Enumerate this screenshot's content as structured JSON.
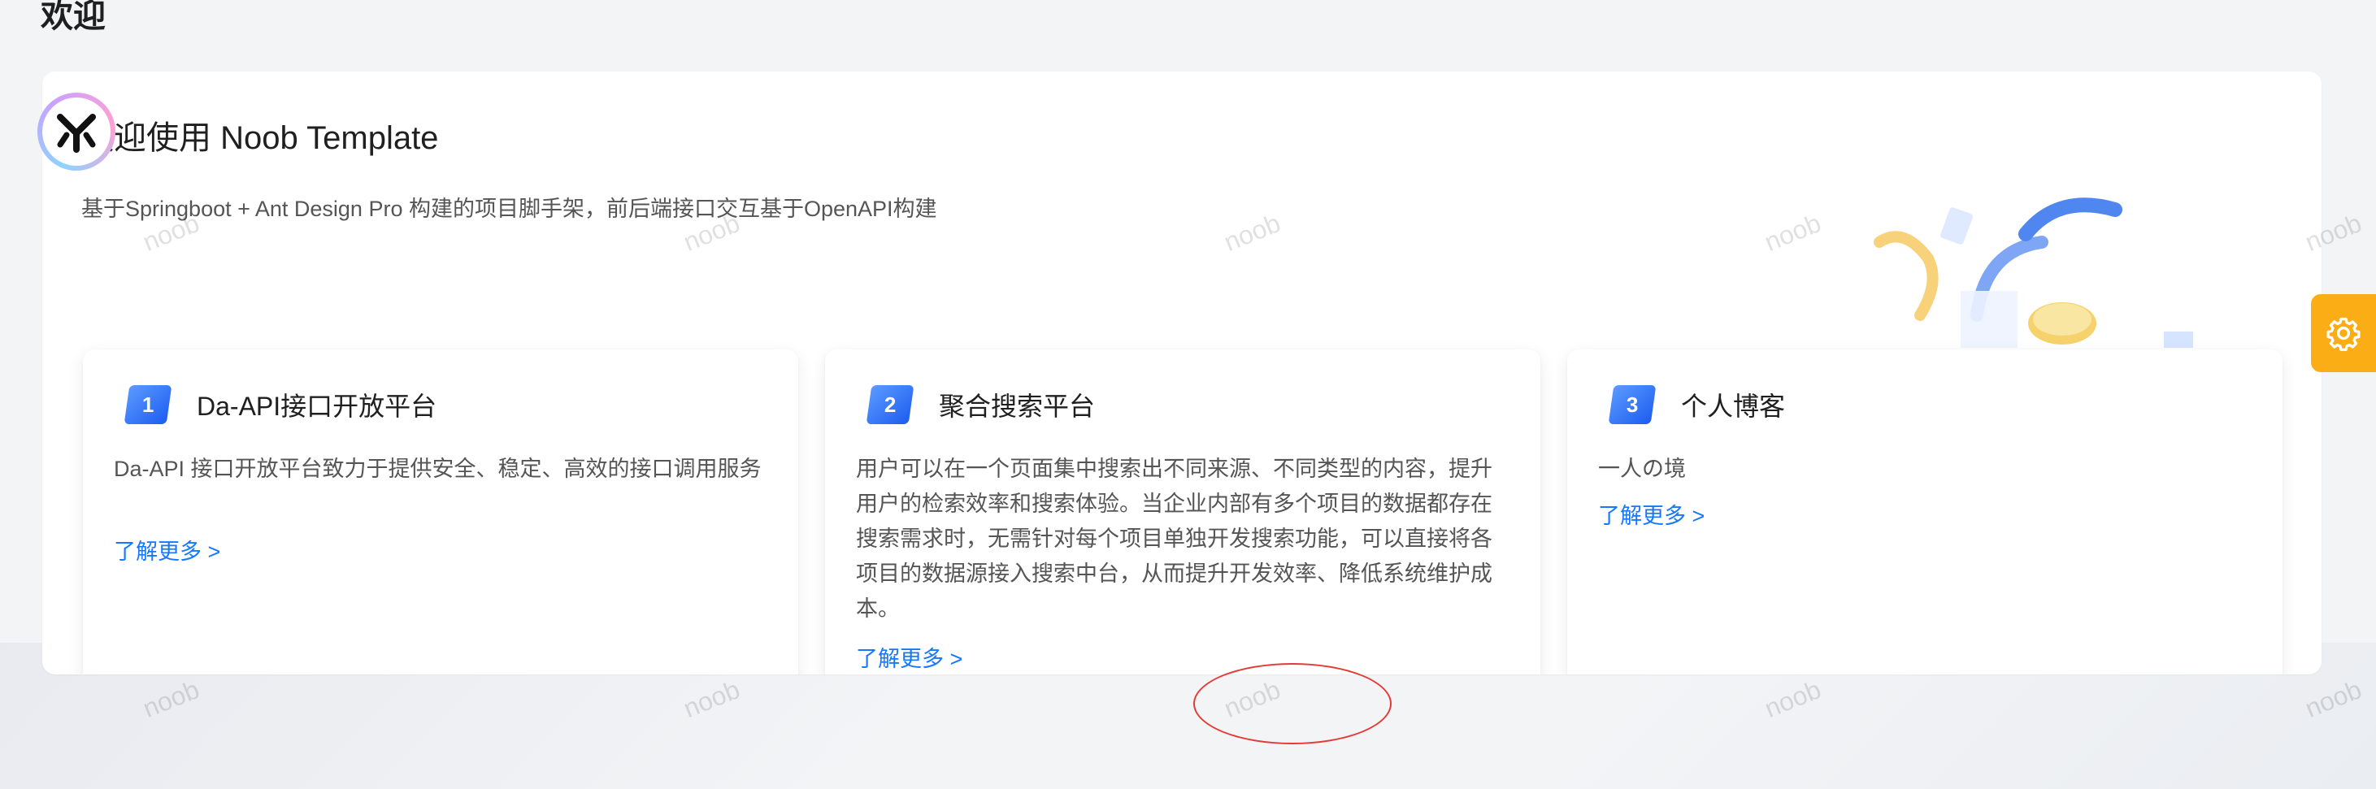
{
  "page": {
    "title": "欢迎"
  },
  "welcome": {
    "title": "欢迎使用 Noob Template",
    "subtitle": "基于Springboot + Ant Design Pro 构建的项目脚手架，前后端接口交互基于OpenAPI构建"
  },
  "cards": [
    {
      "index": "1",
      "title": "Da-API接口开放平台",
      "description": "Da-API 接口开放平台致力于提供安全、稳定、高效的接口调用服务",
      "link": "了解更多 >"
    },
    {
      "index": "2",
      "title": "聚合搜索平台",
      "description": "用户可以在一个页面集中搜索出不同来源、不同类型的内容，提升用户的检索效率和搜索体验。当企业内部有多个项目的数据都存在搜索需求时，无需针对每个项目单独开发搜索功能，可以直接将各项目的数据源接入搜索中台，从而提升开发效率、降低系统维护成本。",
      "link": "了解更多 >"
    },
    {
      "index": "3",
      "title": "个人博客",
      "description": "一人の境",
      "link": "了解更多 >"
    }
  ],
  "watermark": {
    "text": "noob"
  },
  "icons": {
    "settings": "gear-icon",
    "logo": "noob-logo-icon"
  },
  "colors": {
    "accent": "#1677ff",
    "settings_button": "#faad14",
    "badge_gradient_start": "#5b9bff",
    "badge_gradient_end": "#1d5cf0"
  }
}
